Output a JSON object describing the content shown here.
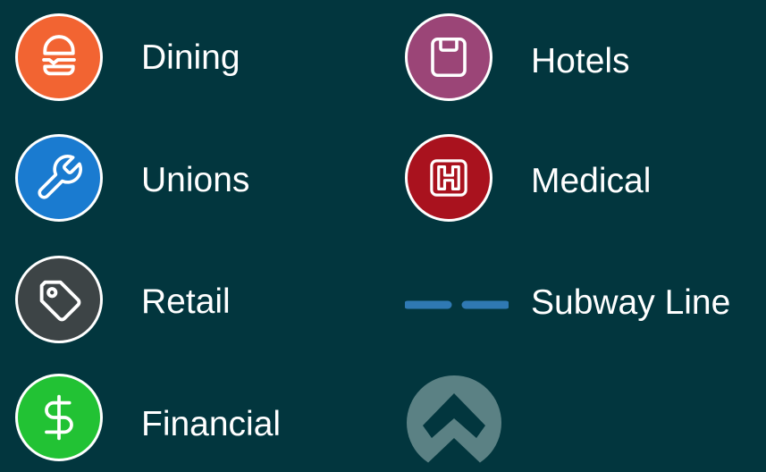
{
  "legend": {
    "items": [
      {
        "id": "dining",
        "label": "Dining",
        "icon": "burger-icon",
        "color": "#f26432"
      },
      {
        "id": "unions",
        "label": "Unions",
        "icon": "wrench-icon",
        "color": "#1a7bd0"
      },
      {
        "id": "retail",
        "label": "Retail",
        "icon": "tag-icon",
        "color": "#3d4446"
      },
      {
        "id": "financial",
        "label": "Financial",
        "icon": "dollar-icon",
        "color": "#22c234"
      },
      {
        "id": "hotels",
        "label": "Hotels",
        "icon": "floppy-disk-icon",
        "color": "#9b4577"
      },
      {
        "id": "medical",
        "label": "Medical",
        "icon": "hospital-h-icon",
        "color": "#a9121e"
      },
      {
        "id": "subway",
        "label": "Subway Line",
        "icon": "dashed-line-icon",
        "color": "#2f79b3"
      }
    ],
    "marker": {
      "icon": "north-arrow-icon",
      "color": "#5b8184"
    }
  }
}
